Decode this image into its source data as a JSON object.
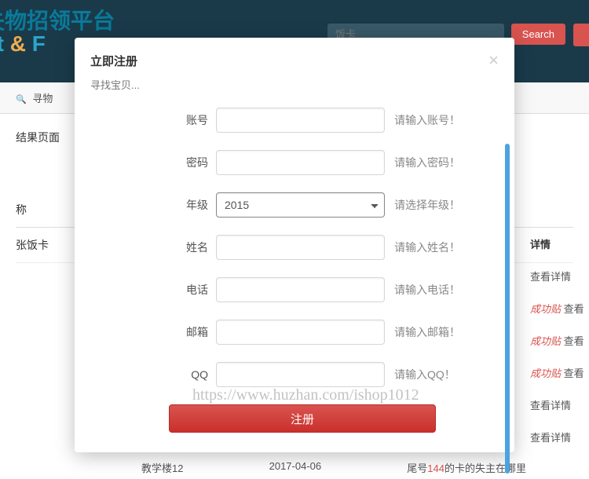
{
  "background": {
    "title_cn": "国失物招领平台",
    "title_en_pre": "st ",
    "title_en_amp": "&",
    "title_en_post": " F",
    "search_placeholder": "饭卡",
    "search_btn": "Search",
    "nav_text": "寻物",
    "result_heading": "结果页面",
    "col_name": "称",
    "row1": "张饭卡",
    "col_detail": "详情",
    "detail_text": "查看详情",
    "success_text": "成功贴",
    "success_suffix": " 查看",
    "bottom_loc": "教学楼12",
    "bottom_date": "2017-04-06",
    "bottom_msg_pre": "尾号",
    "bottom_msg_num": "144",
    "bottom_msg_post": "的卡的失主在哪里"
  },
  "modal": {
    "title": "立即注册",
    "subtitle": "寻找宝贝...",
    "close": "×",
    "fields": {
      "account_label": "账号",
      "account_hint": "请输入账号！",
      "password_label": "密码",
      "password_hint": "请输入密码！",
      "grade_label": "年级",
      "grade_value": "2015",
      "grade_hint": "请选择年级！",
      "name_label": "姓名",
      "name_hint": "请输入姓名！",
      "phone_label": "电话",
      "phone_hint": "请输入电话！",
      "email_label": "邮箱",
      "email_hint": "请输入邮箱！",
      "qq_label": "QQ",
      "qq_hint": "请输入QQ！"
    },
    "submit": "注册"
  },
  "watermark": "https://www.huzhan.com/ishop1012"
}
